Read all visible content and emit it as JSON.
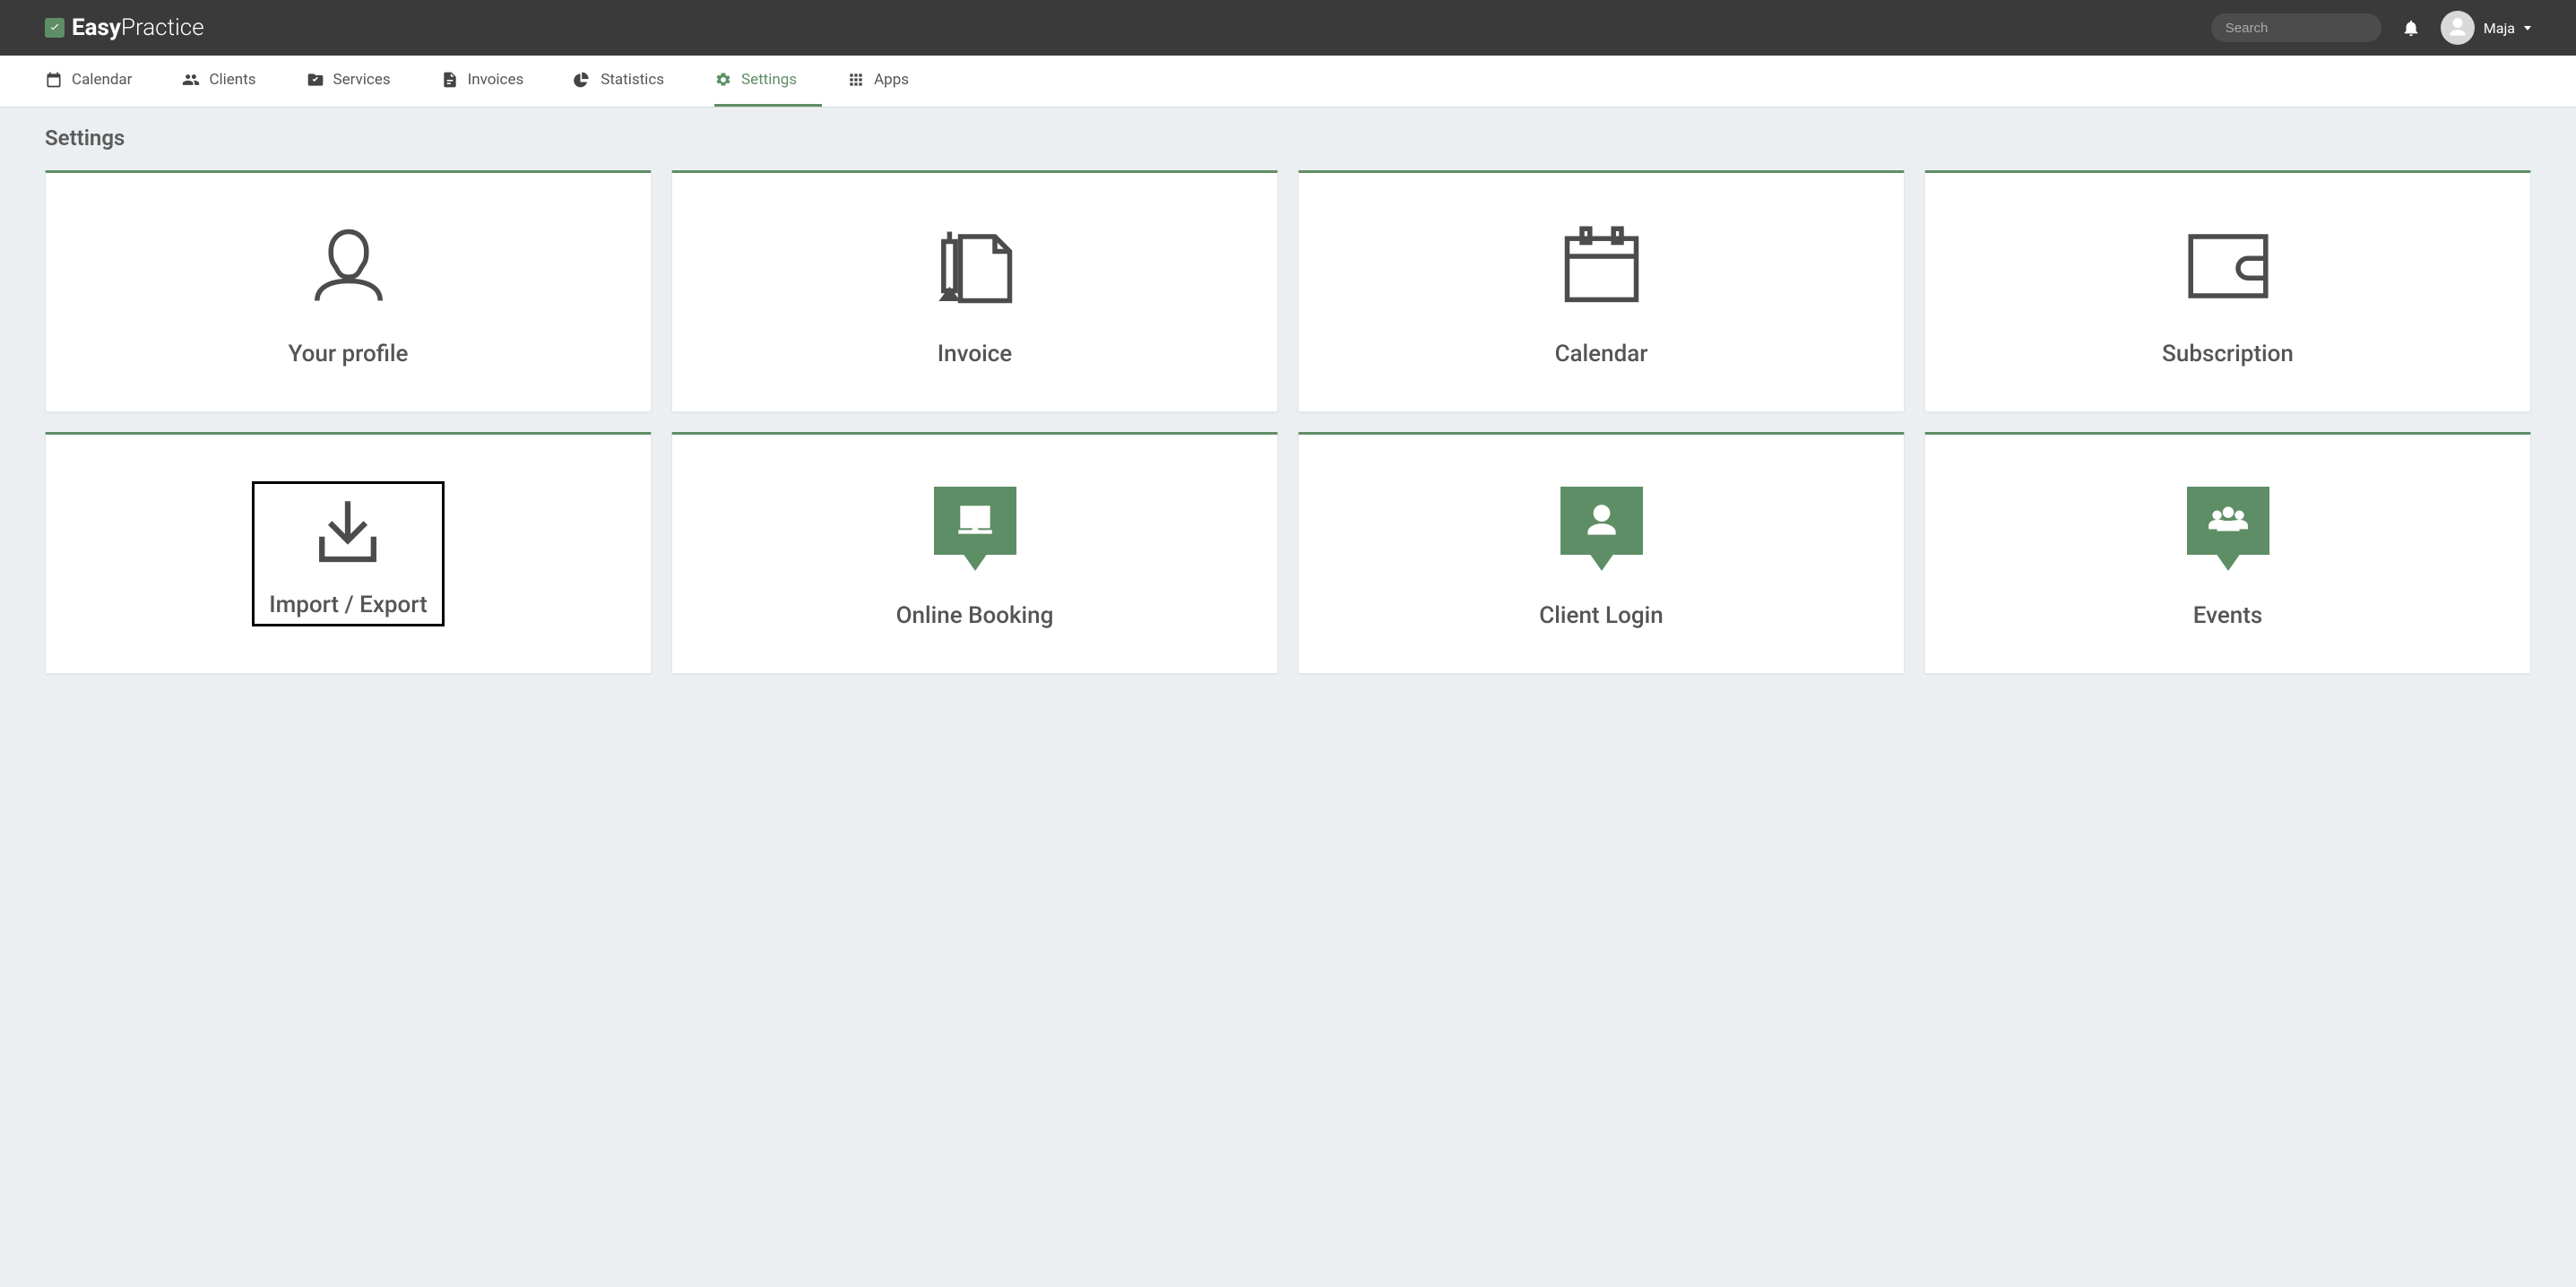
{
  "brand": {
    "bold": "Easy",
    "light": "Practice"
  },
  "search": {
    "placeholder": "Search"
  },
  "user": {
    "name": "Maja"
  },
  "nav": {
    "calendar": "Calendar",
    "clients": "Clients",
    "services": "Services",
    "invoices": "Invoices",
    "statistics": "Statistics",
    "settings": "Settings",
    "apps": "Apps"
  },
  "page_title": "Settings",
  "cards": {
    "profile": "Your profile",
    "invoice": "Invoice",
    "calendar": "Calendar",
    "subscription": "Subscription",
    "import_export": "Import / Export",
    "online_booking": "Online Booking",
    "client_login": "Client Login",
    "events": "Events"
  }
}
